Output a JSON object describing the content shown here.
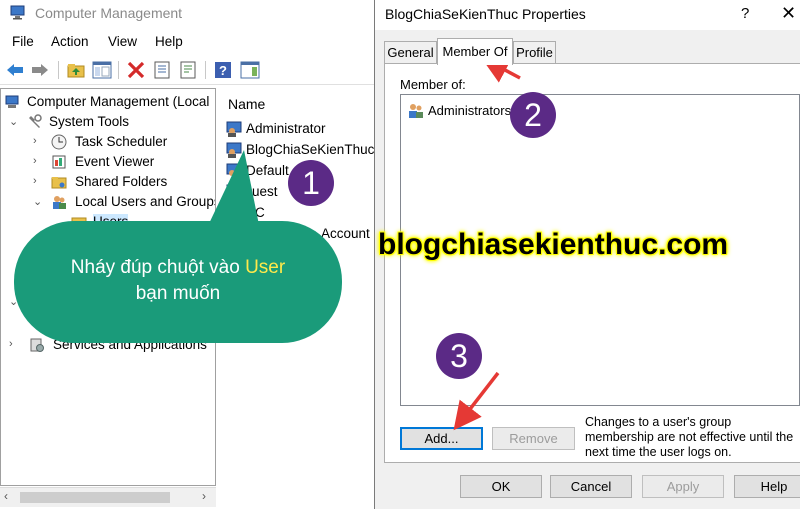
{
  "cm": {
    "title": "Computer Management",
    "menu": [
      "File",
      "Action",
      "View",
      "Help"
    ],
    "tree": {
      "root": "Computer Management (Local",
      "system_tools": "System Tools",
      "task_scheduler": "Task Scheduler",
      "event_viewer": "Event Viewer",
      "shared_folders": "Shared Folders",
      "local_users": "Local Users and Groups",
      "users_partial": "Users",
      "services": "Services and Applications"
    },
    "list": {
      "header": "Name",
      "items": [
        "Administrator",
        "BlogChiaSeKienThuc",
        "DefaultAccount",
        "Guest",
        "PC",
        "WDAGUtilityAccount"
      ],
      "partial_items": [
        "Default",
        "ount",
        "uest",
        "PC",
        "Account"
      ]
    }
  },
  "dialog": {
    "title": "BlogChiaSeKienThuc Properties",
    "help": "?",
    "close": "✕",
    "tabs": [
      "General",
      "Member Of",
      "Profile"
    ],
    "active_tab": "Member Of",
    "member_of_label": "Member of:",
    "groups": [
      "Administrators"
    ],
    "add_button": "Add...",
    "remove_button": "Remove",
    "note": "Changes to a user's group membership are not effective until the next time the user logs on.",
    "ok": "OK",
    "cancel": "Cancel",
    "apply": "Apply",
    "help_button": "Help"
  },
  "annotations": {
    "bubble_line1_prefix": "Nháy đúp chuột vào ",
    "bubble_highlight": "User",
    "bubble_line2": "bạn muốn",
    "step1": "1",
    "step2": "2",
    "step3": "3",
    "watermark": "blogchiasekienthuc.com",
    "bubble_color": "#1a9b7a",
    "step_color": "#5b2a86",
    "arrow_color": "#e53935"
  }
}
